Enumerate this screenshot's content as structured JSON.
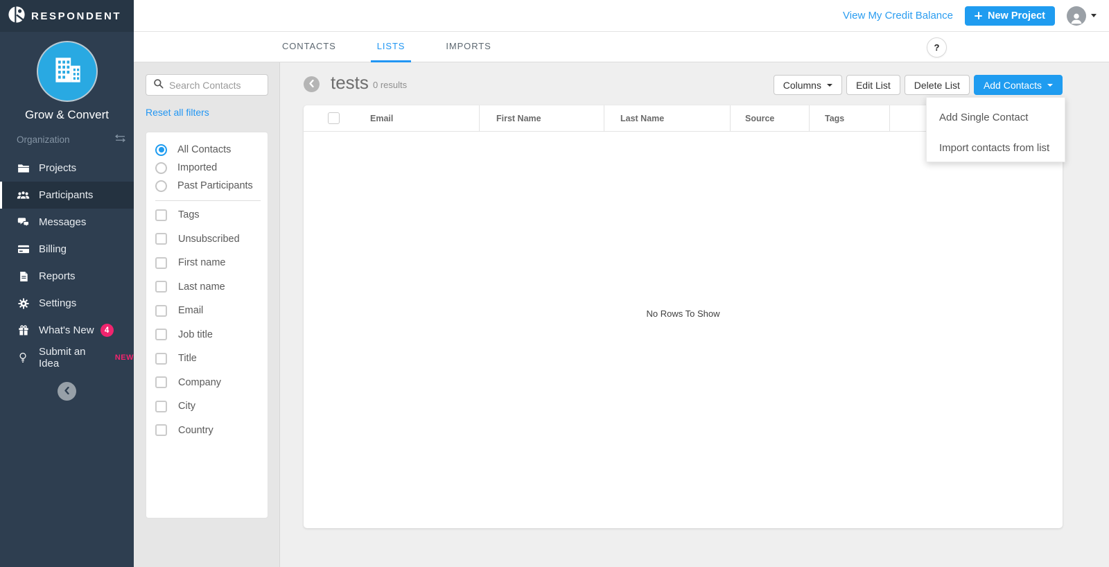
{
  "brand": {
    "name": "RESPONDENT"
  },
  "workspace": {
    "name": "Grow & Convert"
  },
  "sidebar": {
    "section": {
      "label": "Organization"
    },
    "items": [
      {
        "label": "Projects"
      },
      {
        "label": "Participants"
      },
      {
        "label": "Messages"
      },
      {
        "label": "Billing"
      },
      {
        "label": "Reports"
      },
      {
        "label": "Settings"
      },
      {
        "label": "What's New",
        "badge": "4"
      },
      {
        "label": "Submit an Idea",
        "tag": "NEW"
      }
    ]
  },
  "topbar": {
    "credit_balance_link": "View My Credit Balance",
    "new_project_button": "New Project"
  },
  "tabs": {
    "contacts": "CONTACTS",
    "lists": "LISTS",
    "imports": "IMPORTS",
    "help": "?"
  },
  "filters": {
    "search_placeholder": "Search Contacts",
    "reset_link": "Reset all filters",
    "radios": [
      {
        "label": "All Contacts",
        "selected": true
      },
      {
        "label": "Imported",
        "selected": false
      },
      {
        "label": "Past Participants",
        "selected": false
      }
    ],
    "checkboxes": [
      {
        "label": "Tags"
      },
      {
        "label": "Unsubscribed"
      },
      {
        "label": "First name"
      },
      {
        "label": "Last name"
      },
      {
        "label": "Email"
      },
      {
        "label": "Job title"
      },
      {
        "label": "Title"
      },
      {
        "label": "Company"
      },
      {
        "label": "City"
      },
      {
        "label": "Country"
      }
    ]
  },
  "list_view": {
    "title": "tests",
    "results_count": "0 results",
    "buttons": {
      "columns": "Columns",
      "edit_list": "Edit List",
      "delete_list": "Delete List",
      "add_contacts": "Add Contacts"
    },
    "add_contacts_menu": [
      "Add Single Contact",
      "Import contacts from list"
    ],
    "table": {
      "columns": [
        "Email",
        "First Name",
        "Last Name",
        "Source",
        "Tags"
      ],
      "empty_message": "No Rows To Show"
    }
  },
  "colors": {
    "sidebar_navy": "#2e3e50",
    "accent_blue": "#1f9cf0",
    "link_blue": "#2196f3",
    "badge_pink": "#f1246e",
    "workspace_circle_blue": "#29a9e2"
  }
}
